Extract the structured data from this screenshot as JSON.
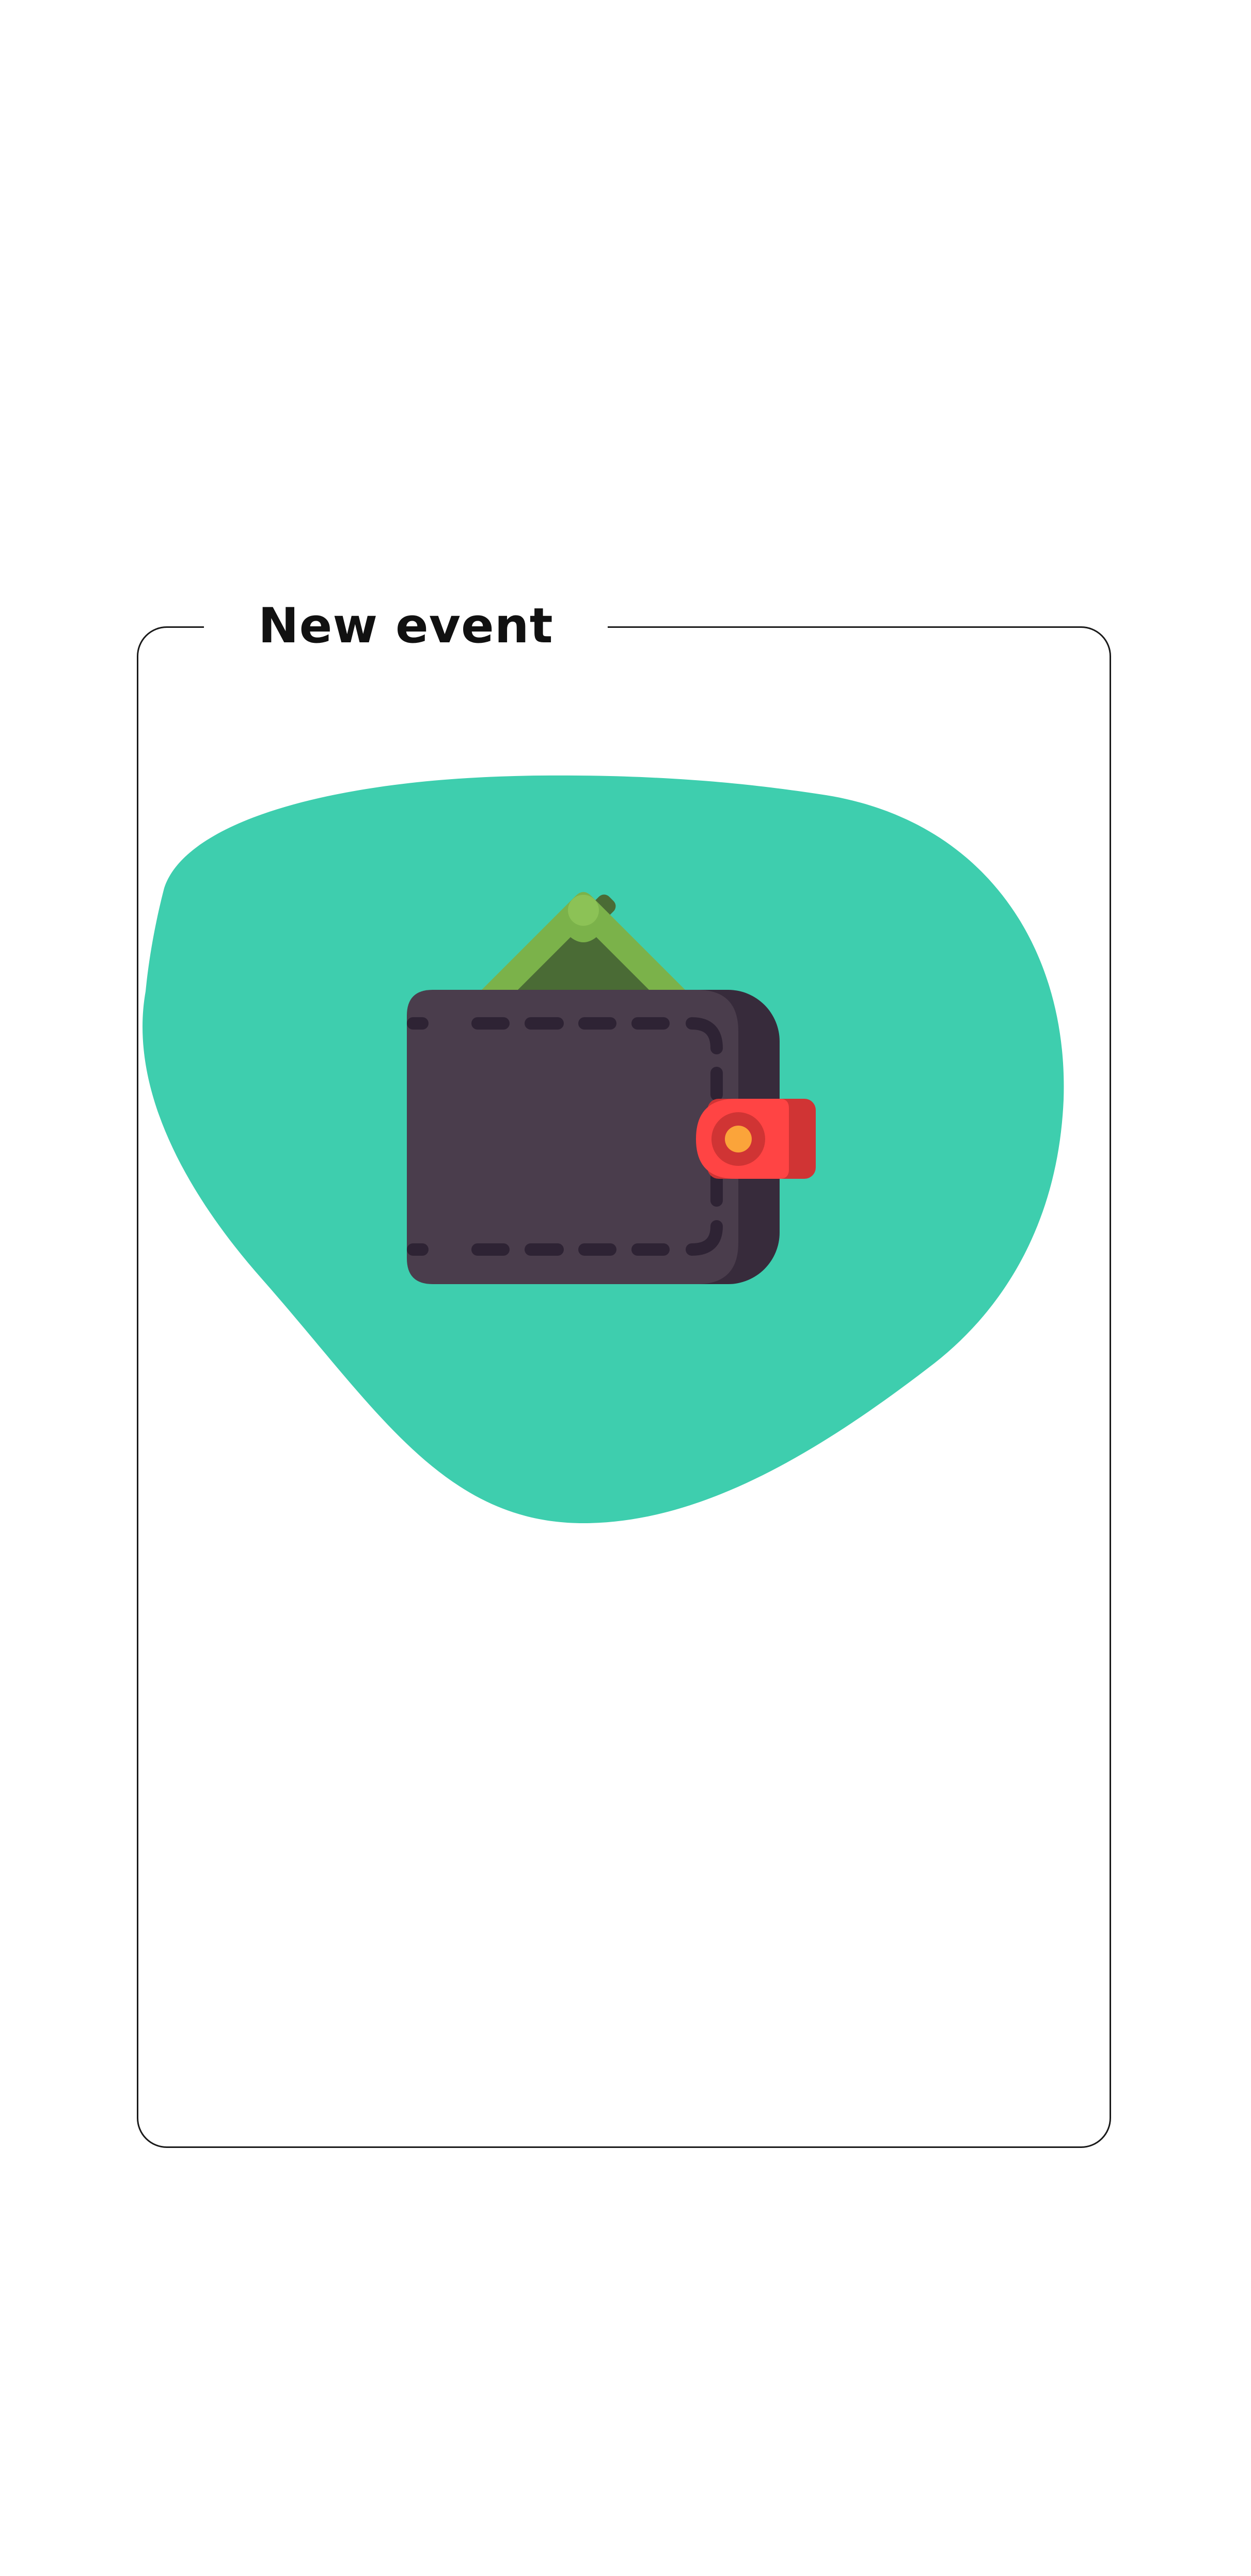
{
  "card": {
    "title": "New event"
  },
  "illustration": {
    "icon": "wallet-icon",
    "blob_color": "#3ECEAE",
    "wallet_color": "#4A3D4C",
    "wallet_shadow_color": "#372B3B",
    "clasp_color": "#FF4444",
    "cash_color": "#7BB24A"
  }
}
